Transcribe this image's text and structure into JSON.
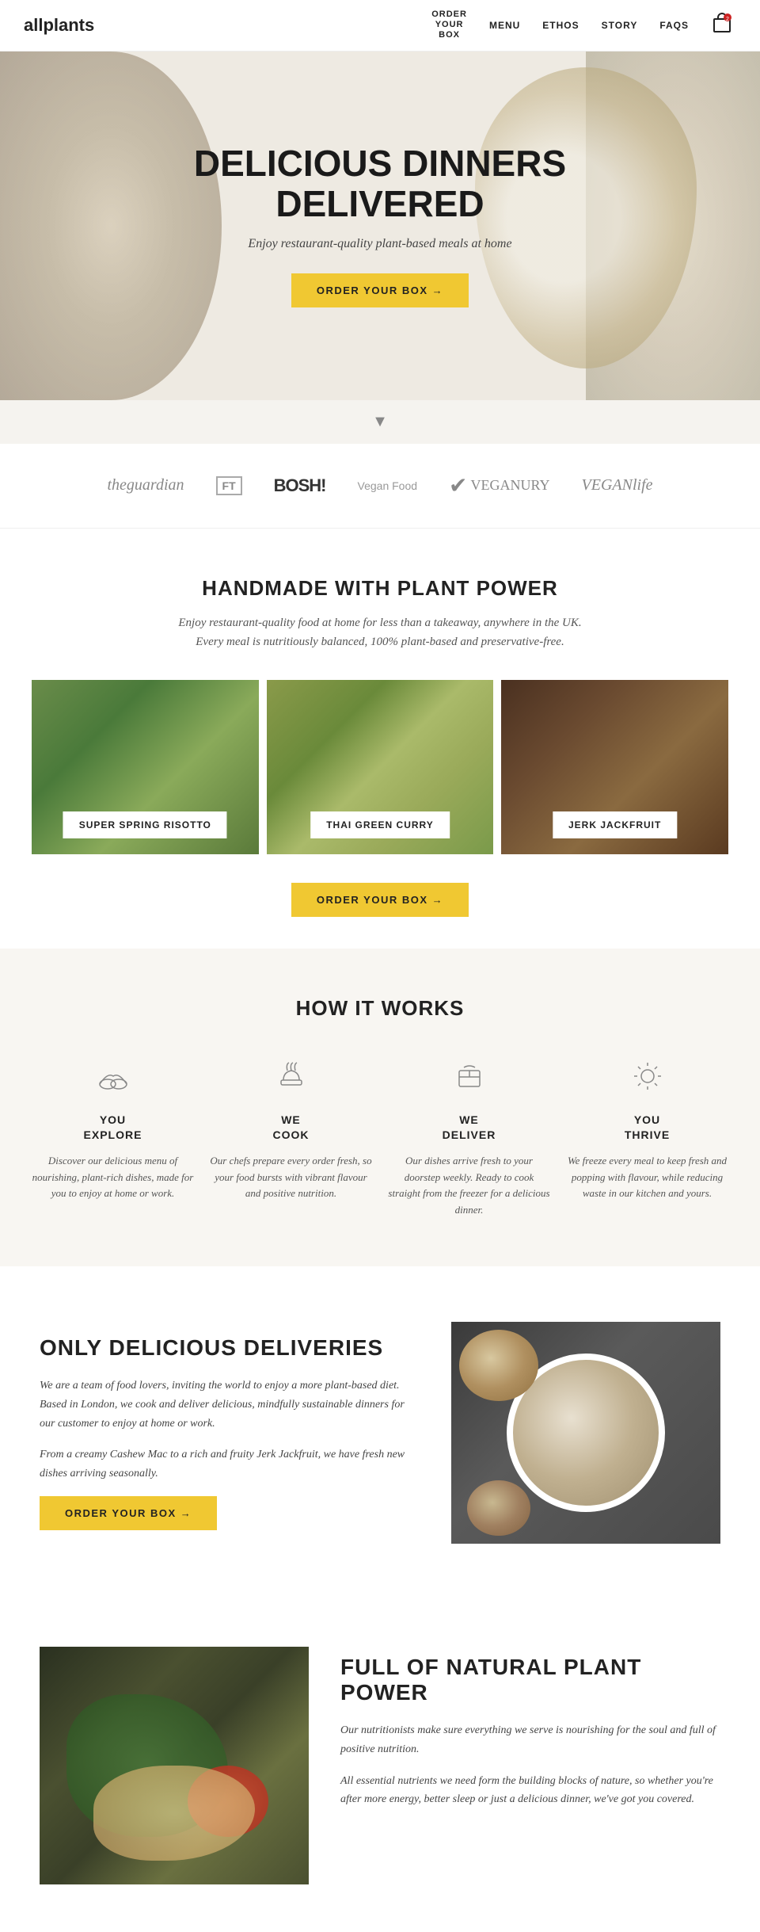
{
  "brand": {
    "name": "allplants"
  },
  "nav": {
    "order_label_line1": "ORDER",
    "order_label_line2": "YOUR",
    "order_label_line3": "BOX",
    "links": [
      {
        "id": "menu",
        "label": "MENU"
      },
      {
        "id": "ethos",
        "label": "ETHOS"
      },
      {
        "id": "story",
        "label": "STORY"
      },
      {
        "id": "faqs",
        "label": "FAQS"
      }
    ]
  },
  "hero": {
    "title_line1": "DELICIOUS DINNERS",
    "title_line2": "DELIVERED",
    "subtitle": "Enjoy restaurant-quality plant-based meals at home",
    "cta": "ORDER YOUR BOX →"
  },
  "press": {
    "logos": [
      {
        "id": "guardian",
        "text": "theguardian",
        "style": "guardian"
      },
      {
        "id": "ft",
        "text": "FT",
        "style": "ft"
      },
      {
        "id": "bosh",
        "text": "BOSH!",
        "style": "bosh"
      },
      {
        "id": "veganfood",
        "text": "Vegan Food",
        "style": "veganfood"
      },
      {
        "id": "veganuary",
        "text": "VEGANURY",
        "style": "veganuary"
      },
      {
        "id": "veganlife",
        "text": "VEGANlife",
        "style": "veganlife"
      }
    ]
  },
  "plant_section": {
    "title": "HANDMADE WITH PLANT POWER",
    "subtitle_line1": "Enjoy restaurant-quality food at home for less than a takeaway, anywhere in the UK.",
    "subtitle_line2": "Every meal is nutritiously balanced, 100% plant-based and preservative-free.",
    "meals": [
      {
        "id": "risotto",
        "label": "SUPER SPRING RISOTTO",
        "img_class": "meal-img-risotto"
      },
      {
        "id": "curry",
        "label": "THAI GREEN CURRY",
        "img_class": "meal-img-curry"
      },
      {
        "id": "jackfruit",
        "label": "JERK JACKFRUIT",
        "img_class": "meal-img-jackfruit"
      }
    ],
    "cta": "ORDER YOUR BOX →"
  },
  "how_section": {
    "title": "HOW IT WORKS",
    "steps": [
      {
        "id": "explore",
        "icon": "👟",
        "title_line1": "YOU",
        "title_line2": "EXPLORE",
        "desc": "Discover our delicious menu of nourishing, plant-rich dishes, made for you to enjoy at home or work."
      },
      {
        "id": "cook",
        "icon": "🍲",
        "title_line1": "WE",
        "title_line2": "COOK",
        "desc": "Our chefs prepare every order fresh, so your food bursts with vibrant flavour and positive nutrition."
      },
      {
        "id": "deliver",
        "icon": "📦",
        "title_line1": "WE",
        "title_line2": "DELIVER",
        "desc": "Our dishes arrive fresh to your doorstep weekly. Ready to cook straight from the freezer for a delicious dinner."
      },
      {
        "id": "thrive",
        "icon": "☀️",
        "title_line1": "YOU",
        "title_line2": "THRIVE",
        "desc": "We freeze every meal to keep fresh and popping with flavour, while reducing waste in our kitchen and yours."
      }
    ]
  },
  "only_section": {
    "title": "ONLY DELICIOUS DELIVERIES",
    "para1": "We are a team of food lovers, inviting the world to enjoy a more plant-based diet. Based in London, we cook and deliver delicious, mindfully sustainable dinners for our customer to enjoy at home or work.",
    "para2": "From a creamy Cashew Mac to a rich and fruity Jerk Jackfruit, we have fresh new dishes arriving seasonally.",
    "cta": "ORDER YOUR BOX →"
  },
  "natural_section": {
    "title": "FULL OF NATURAL PLANT POWER",
    "para1": "Our nutritionists make sure everything we serve is nourishing for the soul and full of positive nutrition.",
    "para2": "All essential nutrients we need form the building blocks of nature, so whether you're after more energy, better sleep or just a delicious dinner, we've got you covered."
  }
}
